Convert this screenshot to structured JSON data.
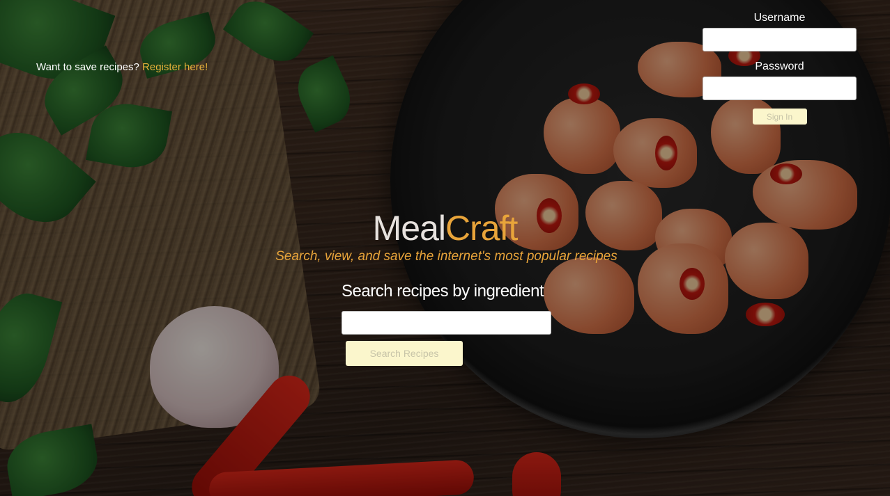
{
  "register": {
    "prompt": "Want to save recipes?",
    "link_label": "Register here!"
  },
  "signin": {
    "username_label": "Username",
    "username_value": "",
    "password_label": "Password",
    "password_value": "",
    "button_label": "Sign In"
  },
  "brand": {
    "part1": "Meal",
    "part2": "Craft",
    "tagline": "Search, view, and save the internet's most popular recipes"
  },
  "search": {
    "heading": "Search recipes by ingredient",
    "value": "",
    "button_label": "Search Recipes"
  },
  "colors": {
    "accent": "#e8a43a",
    "button_bg": "#fbf6cc"
  }
}
